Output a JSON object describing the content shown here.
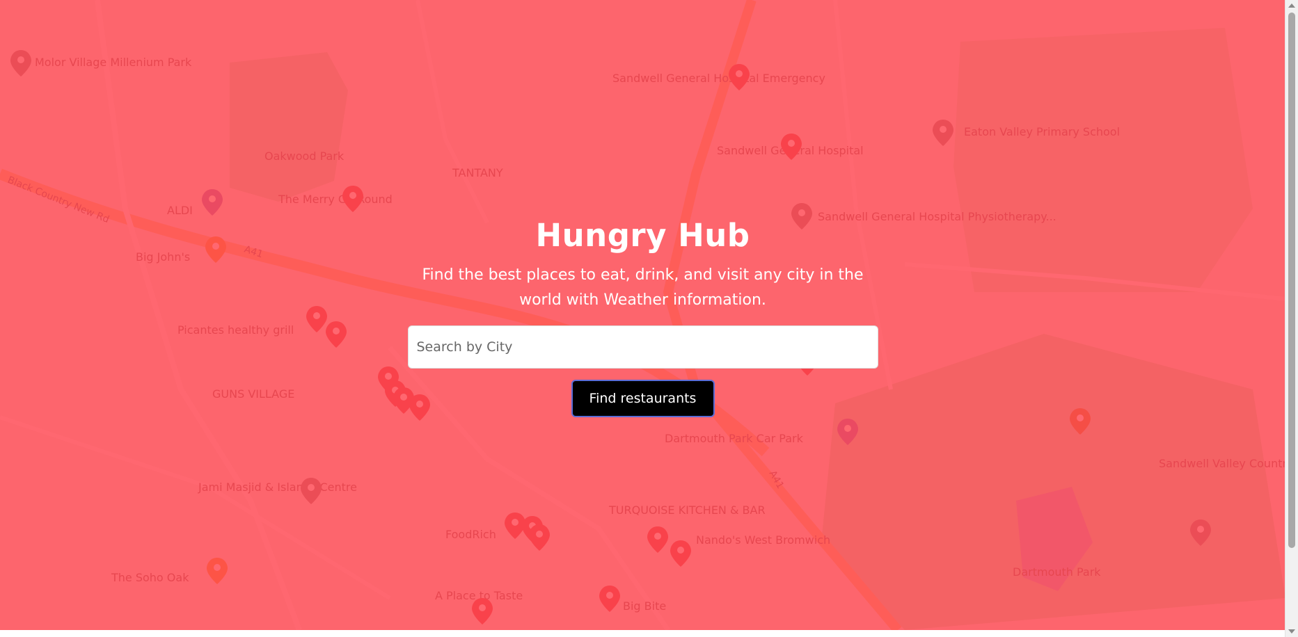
{
  "hero": {
    "title": "Hungry Hub",
    "subtitle": "Find the best places to eat, drink, and visit any city in the world with Weather information."
  },
  "search": {
    "placeholder": "Search by City",
    "value": ""
  },
  "actions": {
    "find_label": "Find restaurants"
  },
  "map": {
    "labels": [
      "Molor Village Millenium Park",
      "Sandwell General Hospital Emergency",
      "Oakwood Park",
      "TANTANY",
      "Sandwell General Hospital",
      "Eaton Valley Primary School",
      "The Merry Go Round",
      "ALDI",
      "Sandwell General Hospital Physiotherapy...",
      "Big John's",
      "Picantes healthy grill",
      "GUNS VILLAGE",
      "Dartmouth Park Car Park",
      "Jami Masjid & Islamic Centre",
      "TURQUOISE KITCHEN & BAR",
      "FoodRich",
      "Nando's West Bromwich",
      "Sandwell Valley Country Park",
      "The Soho Oak",
      "A Place to Taste",
      "Big Bite",
      "Dartmouth Park"
    ],
    "road_labels": [
      "A41",
      "A41",
      "Black Country New Rd"
    ]
  },
  "colors": {
    "overlay": "#ff4650",
    "button_bg": "#000000",
    "button_border": "#5a6cd6",
    "text": "#ffffff"
  },
  "icons": {
    "map_pin": "map-pin-icon"
  }
}
